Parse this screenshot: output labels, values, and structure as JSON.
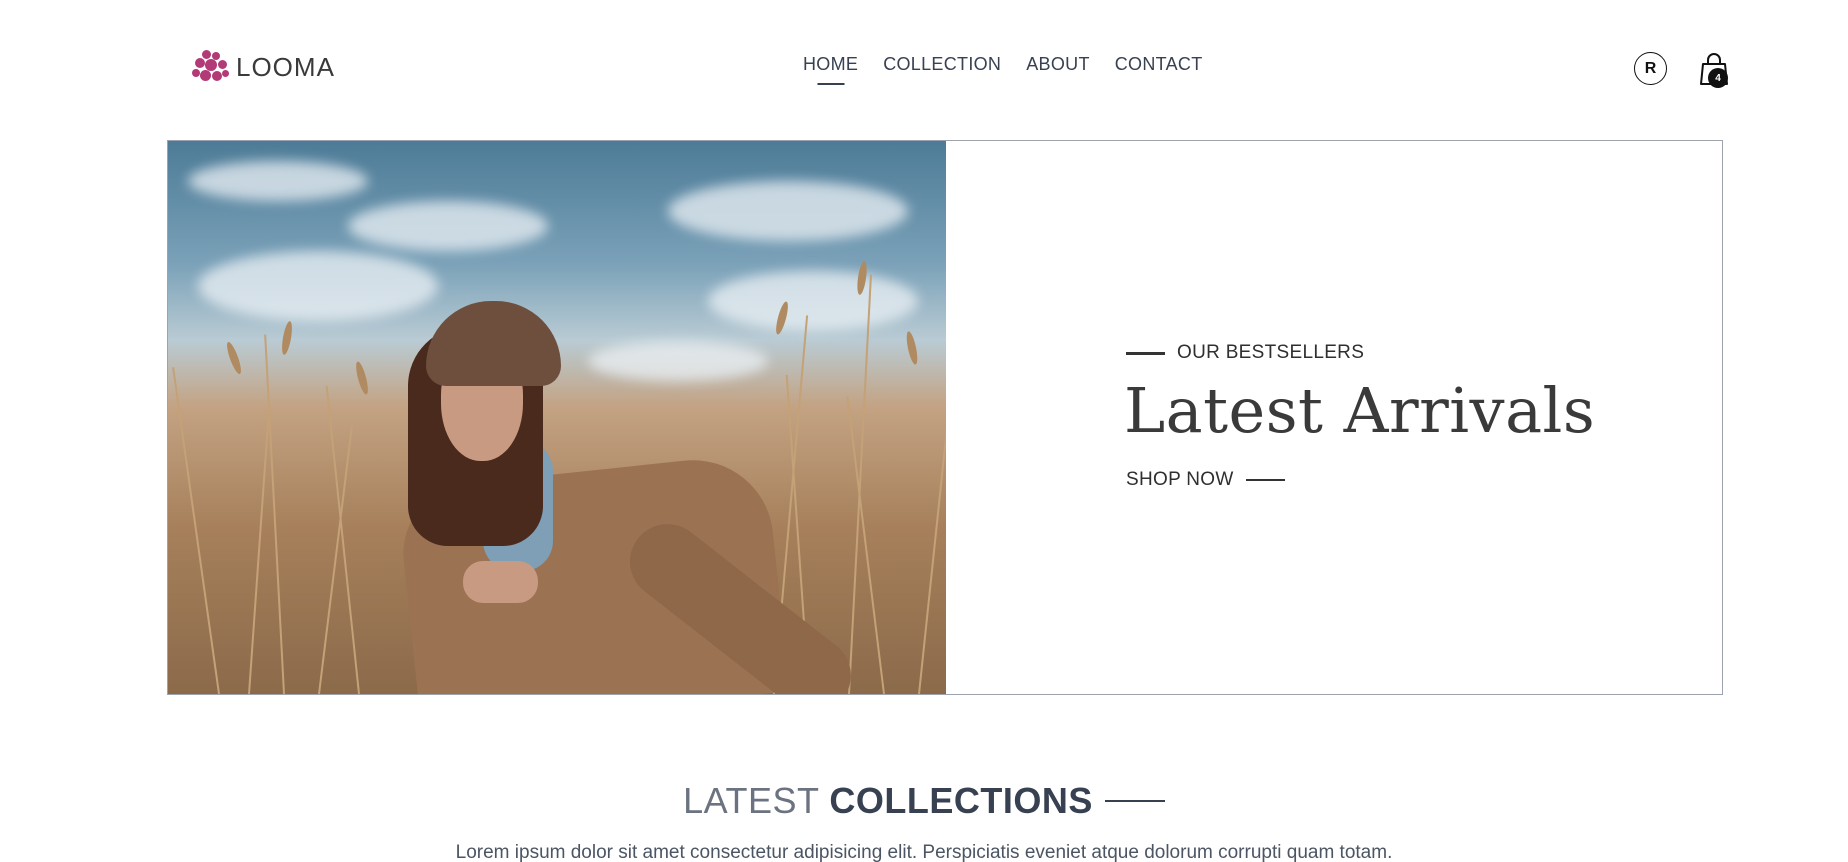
{
  "brand": {
    "name": "LOOMA",
    "accent_color": "#b23a77",
    "logo_icon": "flower-dots-icon"
  },
  "nav": {
    "items": [
      {
        "label": "HOME",
        "active": true
      },
      {
        "label": "COLLECTION",
        "active": false
      },
      {
        "label": "ABOUT",
        "active": false
      },
      {
        "label": "CONTACT",
        "active": false
      }
    ]
  },
  "header_actions": {
    "profile_initial": "R",
    "profile_icon": "profile-icon",
    "cart_icon": "shopping-bag-icon",
    "cart_count": "4"
  },
  "hero": {
    "eyebrow": "OUR BESTSELLERS",
    "title": "Latest Arrivals",
    "cta_label": "SHOP NOW",
    "border_color": "#9ca3af"
  },
  "collections": {
    "title_light": "LATEST",
    "title_bold": "COLLECTIONS",
    "subtitle": "Lorem ipsum dolor sit amet consectetur adipisicing elit. Perspiciatis eveniet atque dolorum corrupti quam totam."
  }
}
